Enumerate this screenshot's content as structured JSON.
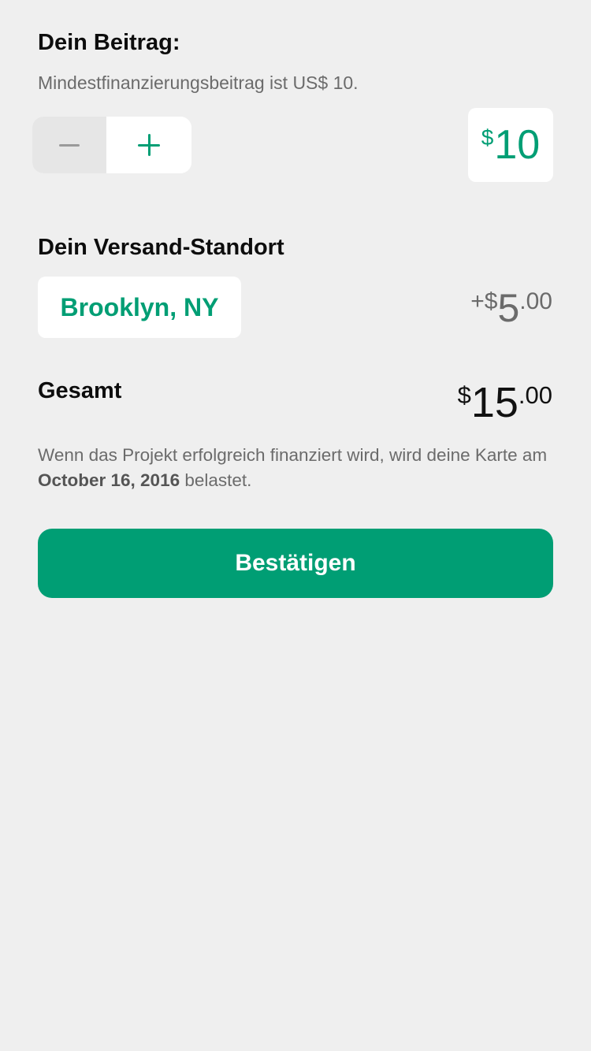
{
  "pledge": {
    "title": "Dein Beitrag:",
    "minimum_text": "Mindestfinanzierungsbeitrag ist US$ 10.",
    "stepper": {
      "decrement_icon": "minus-icon",
      "increment_icon": "plus-icon"
    },
    "amount_currency": "$",
    "amount_value": "10"
  },
  "shipping": {
    "title": "Dein Versand-Standort",
    "location_label": "Brooklyn, NY",
    "price_prefix": "+$",
    "price_major": "5",
    "price_minor": ".00"
  },
  "total": {
    "label": "Gesamt",
    "price_prefix": "$",
    "price_major": "15",
    "price_minor": ".00"
  },
  "note": {
    "text_before": "Wenn das Projekt erfolgreich finanziert wird, wird deine Karte am ",
    "date": "October 16, 2016",
    "text_after": " belastet."
  },
  "confirm_label": "Bestätigen",
  "colors": {
    "accent": "#009e74",
    "background": "#efefef",
    "muted_text": "#6b6b6b"
  }
}
